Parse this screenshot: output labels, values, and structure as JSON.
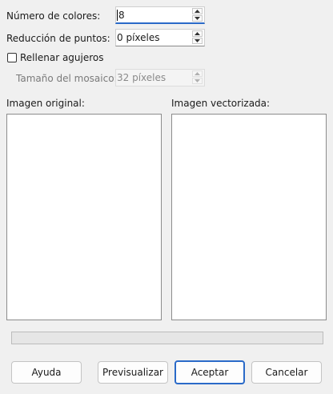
{
  "form": {
    "num_colors": {
      "label": "Número de colores:",
      "value": "8"
    },
    "dot_reduction": {
      "label": "Reducción de puntos:",
      "value": "0 píxeles"
    },
    "fill_holes": {
      "label": "Rellenar agujeros",
      "checked": false
    },
    "tile_size": {
      "label": "Tamaño del mosaico:",
      "value": "32 píxeles",
      "enabled": false
    }
  },
  "preview": {
    "original_label": "Imagen original:",
    "vectorized_label": "Imagen vectorizada:"
  },
  "progress": {
    "value": 0
  },
  "buttons": {
    "help": "Ayuda",
    "preview": "Previsualizar",
    "ok": "Aceptar",
    "cancel": "Cancelar"
  },
  "colors": {
    "accent": "#2a6ac8",
    "background": "#f0f0f0",
    "progress_fill": "#06b025"
  }
}
